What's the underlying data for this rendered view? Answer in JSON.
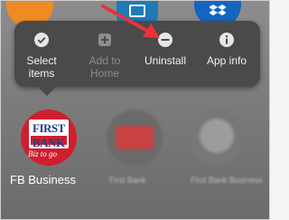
{
  "menu": {
    "items": [
      {
        "label_line1": "Select",
        "label_line2": "items",
        "icon": "check-circle-icon",
        "enabled": true
      },
      {
        "label_line1": "Add to",
        "label_line2": "Home",
        "icon": "add-box-icon",
        "enabled": false
      },
      {
        "label_line1": "Uninstall",
        "label_line2": "",
        "icon": "minus-circle-icon",
        "enabled": true
      },
      {
        "label_line1": "App info",
        "label_line2": "",
        "icon": "info-circle-icon",
        "enabled": true
      }
    ]
  },
  "apps": [
    {
      "label": "FB Business",
      "icon_text": "FIRST BANK",
      "tagline": "Biz to go"
    },
    {
      "label": "First Bank",
      "blurred": true
    },
    {
      "label": "First Bank Business",
      "blurred": true
    }
  ],
  "colors": {
    "menu_bg": "#4a4a4a",
    "arrow": "#e8333c",
    "fb_red": "#cf1f2e"
  }
}
